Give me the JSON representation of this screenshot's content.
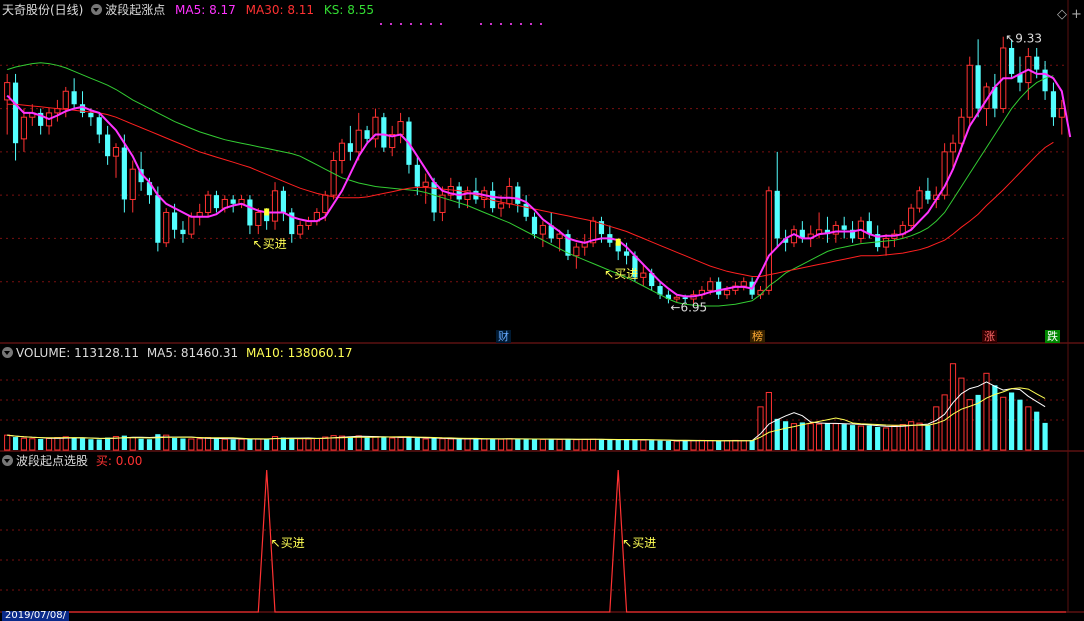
{
  "header": {
    "stock_name": "天奇股份(日线)",
    "indicator": "波段起涨点",
    "ma5": "MA5: 8.17",
    "ma30": "MA30: 8.11",
    "ks": "KS: 8.55"
  },
  "volume_panel": {
    "volume": "VOLUME: 113128.11",
    "ma5": "MA5: 81460.31",
    "ma10": "MA10: 138060.17"
  },
  "signal_panel": {
    "title": "波段起点选股",
    "buy_value": "买: 0.00"
  },
  "annotations": {
    "buy_label": "买进",
    "high_label": "9.33",
    "low_label": "6.95"
  },
  "event_badges": [
    "财",
    "榜",
    "涨",
    "跌"
  ],
  "footer_date": "2019/07/08/",
  "colors": {
    "up": "#ff3232",
    "down": "#54ffff",
    "ma5": "#ff33ff",
    "ma30_long": "#ff2020",
    "ks": "#33cc33",
    "label_yellow": "#ffff55",
    "grid": "#7a1010"
  },
  "chart_data": {
    "type": "candlestick",
    "ohlc": [
      [
        8.6,
        8.9,
        8.2,
        8.8
      ],
      [
        8.8,
        8.9,
        7.9,
        8.1
      ],
      [
        8.15,
        8.5,
        8.0,
        8.4
      ],
      [
        8.4,
        8.55,
        8.3,
        8.45
      ],
      [
        8.45,
        8.5,
        8.2,
        8.3
      ],
      [
        8.3,
        8.5,
        8.2,
        8.45
      ],
      [
        8.45,
        8.6,
        8.35,
        8.5
      ],
      [
        8.5,
        8.75,
        8.4,
        8.7
      ],
      [
        8.7,
        8.85,
        8.5,
        8.55
      ],
      [
        8.55,
        8.7,
        8.4,
        8.45
      ],
      [
        8.45,
        8.5,
        8.3,
        8.4
      ],
      [
        8.4,
        8.45,
        8.1,
        8.2
      ],
      [
        8.2,
        8.3,
        7.85,
        7.95
      ],
      [
        7.95,
        8.1,
        7.7,
        8.05
      ],
      [
        8.05,
        8.2,
        7.3,
        7.45
      ],
      [
        7.45,
        7.9,
        7.3,
        7.8
      ],
      [
        7.8,
        8.0,
        7.55,
        7.65
      ],
      [
        7.65,
        7.7,
        7.4,
        7.5
      ],
      [
        7.5,
        7.6,
        6.85,
        6.95
      ],
      [
        6.95,
        7.35,
        6.9,
        7.3
      ],
      [
        7.3,
        7.4,
        7.0,
        7.1
      ],
      [
        7.1,
        7.2,
        6.95,
        7.05
      ],
      [
        7.05,
        7.3,
        7.0,
        7.25
      ],
      [
        7.25,
        7.4,
        7.15,
        7.3
      ],
      [
        7.3,
        7.55,
        7.25,
        7.5
      ],
      [
        7.5,
        7.55,
        7.3,
        7.35
      ],
      [
        7.35,
        7.5,
        7.3,
        7.45
      ],
      [
        7.45,
        7.5,
        7.3,
        7.4
      ],
      [
        7.4,
        7.5,
        7.35,
        7.45
      ],
      [
        7.45,
        7.5,
        7.05,
        7.15
      ],
      [
        7.15,
        7.35,
        7.05,
        7.3
      ],
      [
        7.3,
        7.35,
        7.1,
        7.2
      ],
      [
        7.2,
        7.65,
        7.1,
        7.55
      ],
      [
        7.55,
        7.6,
        7.2,
        7.3
      ],
      [
        7.3,
        7.35,
        6.95,
        7.05
      ],
      [
        7.05,
        7.2,
        7.0,
        7.15
      ],
      [
        7.15,
        7.25,
        7.1,
        7.2
      ],
      [
        7.2,
        7.35,
        7.15,
        7.3
      ],
      [
        7.3,
        7.55,
        7.2,
        7.5
      ],
      [
        7.5,
        8.0,
        7.45,
        7.9
      ],
      [
        7.9,
        8.15,
        7.75,
        8.1
      ],
      [
        8.1,
        8.3,
        7.9,
        8.0
      ],
      [
        8.0,
        8.45,
        7.9,
        8.25
      ],
      [
        8.25,
        8.3,
        8.1,
        8.15
      ],
      [
        8.15,
        8.5,
        8.05,
        8.4
      ],
      [
        8.4,
        8.45,
        8.0,
        8.05
      ],
      [
        8.05,
        8.3,
        7.95,
        8.2
      ],
      [
        8.2,
        8.45,
        8.1,
        8.35
      ],
      [
        8.35,
        8.4,
        7.75,
        7.85
      ],
      [
        7.85,
        7.95,
        7.5,
        7.6
      ],
      [
        7.6,
        7.75,
        7.4,
        7.65
      ],
      [
        7.65,
        7.7,
        7.2,
        7.3
      ],
      [
        7.3,
        7.6,
        7.2,
        7.5
      ],
      [
        7.5,
        7.7,
        7.45,
        7.6
      ],
      [
        7.6,
        7.65,
        7.35,
        7.45
      ],
      [
        7.45,
        7.6,
        7.35,
        7.55
      ],
      [
        7.55,
        7.7,
        7.4,
        7.45
      ],
      [
        7.45,
        7.6,
        7.35,
        7.55
      ],
      [
        7.55,
        7.65,
        7.3,
        7.35
      ],
      [
        7.35,
        7.5,
        7.25,
        7.4
      ],
      [
        7.4,
        7.7,
        7.35,
        7.6
      ],
      [
        7.6,
        7.65,
        7.3,
        7.4
      ],
      [
        7.4,
        7.5,
        7.2,
        7.25
      ],
      [
        7.25,
        7.3,
        7.0,
        7.05
      ],
      [
        7.05,
        7.2,
        6.9,
        7.15
      ],
      [
        7.15,
        7.3,
        6.95,
        7.0
      ],
      [
        7.0,
        7.1,
        6.85,
        7.05
      ],
      [
        7.05,
        7.1,
        6.75,
        6.8
      ],
      [
        6.8,
        6.95,
        6.65,
        6.9
      ],
      [
        6.9,
        7.05,
        6.8,
        6.95
      ],
      [
        6.95,
        7.25,
        6.9,
        7.2
      ],
      [
        7.2,
        7.25,
        6.95,
        7.05
      ],
      [
        7.05,
        7.15,
        6.9,
        6.95
      ],
      [
        6.95,
        7.0,
        6.75,
        6.85
      ],
      [
        6.85,
        6.95,
        6.7,
        6.8
      ],
      [
        6.8,
        6.85,
        6.5,
        6.55
      ],
      [
        6.55,
        6.7,
        6.45,
        6.6
      ],
      [
        6.6,
        6.65,
        6.4,
        6.45
      ],
      [
        6.45,
        6.5,
        6.3,
        6.35
      ],
      [
        6.35,
        6.4,
        6.25,
        6.3
      ],
      [
        6.3,
        6.35,
        6.26,
        6.32
      ],
      [
        6.32,
        6.35,
        6.25,
        6.3
      ],
      [
        6.3,
        6.4,
        6.25,
        6.35
      ],
      [
        6.35,
        6.45,
        6.3,
        6.4
      ],
      [
        6.4,
        6.55,
        6.35,
        6.5
      ],
      [
        6.5,
        6.55,
        6.3,
        6.35
      ],
      [
        6.35,
        6.45,
        6.3,
        6.4
      ],
      [
        6.4,
        6.5,
        6.35,
        6.45
      ],
      [
        6.45,
        6.55,
        6.4,
        6.5
      ],
      [
        6.5,
        6.55,
        6.3,
        6.35
      ],
      [
        6.35,
        6.45,
        6.3,
        6.4
      ],
      [
        6.4,
        7.6,
        6.35,
        7.55
      ],
      [
        7.55,
        8.0,
        6.9,
        7.0
      ],
      [
        7.0,
        7.1,
        6.85,
        6.95
      ],
      [
        6.95,
        7.15,
        6.9,
        7.1
      ],
      [
        7.1,
        7.2,
        6.95,
        7.0
      ],
      [
        7.0,
        7.15,
        6.9,
        7.05
      ],
      [
        7.05,
        7.3,
        7.0,
        7.1
      ],
      [
        7.1,
        7.25,
        6.95,
        7.05
      ],
      [
        7.05,
        7.2,
        6.95,
        7.15
      ],
      [
        7.15,
        7.25,
        7.0,
        7.1
      ],
      [
        7.1,
        7.2,
        6.95,
        7.0
      ],
      [
        7.0,
        7.25,
        6.95,
        7.2
      ],
      [
        7.2,
        7.3,
        7.0,
        7.05
      ],
      [
        7.05,
        7.15,
        6.85,
        6.9
      ],
      [
        6.9,
        7.05,
        6.8,
        7.0
      ],
      [
        7.0,
        7.1,
        6.9,
        7.05
      ],
      [
        7.05,
        7.2,
        7.0,
        7.15
      ],
      [
        7.15,
        7.4,
        7.1,
        7.35
      ],
      [
        7.35,
        7.6,
        7.3,
        7.55
      ],
      [
        7.55,
        7.7,
        7.4,
        7.45
      ],
      [
        7.45,
        7.6,
        7.35,
        7.5
      ],
      [
        7.5,
        8.1,
        7.45,
        8.0
      ],
      [
        8.0,
        8.2,
        7.8,
        8.1
      ],
      [
        8.1,
        8.5,
        8.0,
        8.4
      ],
      [
        8.4,
        9.1,
        8.3,
        9.0
      ],
      [
        9.0,
        9.3,
        8.4,
        8.5
      ],
      [
        8.5,
        8.8,
        8.3,
        8.75
      ],
      [
        8.75,
        8.9,
        8.4,
        8.5
      ],
      [
        8.5,
        9.33,
        8.45,
        9.2
      ],
      [
        9.2,
        9.3,
        8.85,
        8.9
      ],
      [
        8.9,
        9.1,
        8.7,
        8.8
      ],
      [
        8.8,
        9.2,
        8.6,
        9.1
      ],
      [
        9.1,
        9.2,
        8.85,
        8.95
      ],
      [
        8.95,
        9.05,
        8.6,
        8.7
      ],
      [
        8.7,
        8.8,
        8.3,
        8.4
      ],
      [
        8.4,
        8.6,
        8.2,
        8.5
      ]
    ],
    "volume": [
      62000,
      54000,
      49000,
      47000,
      46000,
      48000,
      52000,
      55000,
      51000,
      48000,
      45000,
      44000,
      52000,
      56000,
      60000,
      52000,
      47000,
      45000,
      66000,
      62000,
      50000,
      48000,
      46000,
      47000,
      52000,
      48000,
      45000,
      44000,
      45000,
      47000,
      46000,
      45000,
      56000,
      52000,
      49000,
      47000,
      46000,
      48000,
      54000,
      60000,
      58000,
      55000,
      59000,
      52000,
      56000,
      53000,
      50000,
      52000,
      55000,
      50000,
      46000,
      48000,
      47000,
      46000,
      45000,
      46000,
      47000,
      46000,
      48000,
      45000,
      47000,
      46000,
      45000,
      46000,
      44000,
      45000,
      44000,
      46000,
      43000,
      44000,
      45000,
      43000,
      42000,
      43000,
      42000,
      44000,
      41000,
      40000,
      39000,
      38000,
      37000,
      38000,
      39000,
      40000,
      39000,
      38000,
      39000,
      40000,
      39000,
      41000,
      180000,
      240000,
      130000,
      120000,
      110000,
      115000,
      110000,
      108000,
      112000,
      110000,
      108000,
      104000,
      100000,
      102000,
      96000,
      92000,
      100000,
      106000,
      118000,
      112000,
      104000,
      180000,
      230000,
      360000,
      300000,
      210000,
      230000,
      320000,
      270000,
      220000,
      240000,
      210000,
      180000,
      160000,
      113128
    ],
    "ma5": [
      8.65,
      8.55,
      8.45,
      8.45,
      8.42,
      8.38,
      8.42,
      8.47,
      8.5,
      8.52,
      8.48,
      8.45,
      8.35,
      8.25,
      8.1,
      7.95,
      7.75,
      7.65,
      7.5,
      7.4,
      7.35,
      7.3,
      7.25,
      7.25,
      7.25,
      7.28,
      7.35,
      7.38,
      7.4,
      7.36,
      7.32,
      7.3,
      7.3,
      7.3,
      7.25,
      7.22,
      7.2,
      7.2,
      7.25,
      7.4,
      7.55,
      7.75,
      7.95,
      8.1,
      8.2,
      8.2,
      8.18,
      8.2,
      8.1,
      7.95,
      7.8,
      7.65,
      7.55,
      7.52,
      7.5,
      7.52,
      7.52,
      7.5,
      7.48,
      7.47,
      7.47,
      7.46,
      7.42,
      7.33,
      7.22,
      7.15,
      7.08,
      7.0,
      6.97,
      6.95,
      6.98,
      7.0,
      7.0,
      6.98,
      6.9,
      6.8,
      6.7,
      6.6,
      6.5,
      6.42,
      6.35,
      6.33,
      6.33,
      6.35,
      6.38,
      6.4,
      6.42,
      6.44,
      6.44,
      6.42,
      6.6,
      6.8,
      6.9,
      7.0,
      7.05,
      7.0,
      7.0,
      7.05,
      7.06,
      7.08,
      7.08,
      7.08,
      7.1,
      7.05,
      7.02,
      7.03,
      7.03,
      7.05,
      7.1,
      7.2,
      7.3,
      7.45,
      7.6,
      7.8,
      8.05,
      8.3,
      8.45,
      8.6,
      8.75,
      8.85,
      8.85,
      8.9,
      8.95,
      8.9,
      8.9,
      8.85,
      8.7,
      8.17
    ],
    "ma30": [
      8.55,
      8.55,
      8.54,
      8.53,
      8.52,
      8.51,
      8.5,
      8.49,
      8.48,
      8.47,
      8.46,
      8.45,
      8.43,
      8.4,
      8.36,
      8.32,
      8.28,
      8.24,
      8.2,
      8.16,
      8.12,
      8.08,
      8.04,
      8.0,
      7.97,
      7.94,
      7.91,
      7.88,
      7.85,
      7.82,
      7.78,
      7.74,
      7.7,
      7.66,
      7.62,
      7.58,
      7.55,
      7.52,
      7.5,
      7.48,
      7.47,
      7.47,
      7.47,
      7.48,
      7.5,
      7.52,
      7.54,
      7.56,
      7.58,
      7.59,
      7.59,
      7.58,
      7.57,
      7.56,
      7.55,
      7.53,
      7.5,
      7.47,
      7.44,
      7.42,
      7.4,
      7.38,
      7.36,
      7.34,
      7.32,
      7.3,
      7.28,
      7.26,
      7.24,
      7.22,
      7.2,
      7.17,
      7.14,
      7.11,
      7.08,
      7.04,
      7.0,
      6.96,
      6.92,
      6.88,
      6.84,
      6.8,
      6.76,
      6.72,
      6.68,
      6.65,
      6.62,
      6.6,
      6.58,
      6.56,
      6.56,
      6.58,
      6.6,
      6.62,
      6.64,
      6.66,
      6.68,
      6.7,
      6.72,
      6.74,
      6.76,
      6.78,
      6.8,
      6.8,
      6.8,
      6.81,
      6.82,
      6.83,
      6.85,
      6.87,
      6.9,
      6.94,
      6.98,
      7.05,
      7.13,
      7.2,
      7.28,
      7.38,
      7.47,
      7.56,
      7.66,
      7.76,
      7.86,
      7.96,
      8.05,
      8.11
    ],
    "ks": [
      8.95,
      8.98,
      9.0,
      9.02,
      9.03,
      9.02,
      9.0,
      8.97,
      8.93,
      8.89,
      8.85,
      8.81,
      8.77,
      8.72,
      8.66,
      8.6,
      8.55,
      8.5,
      8.45,
      8.4,
      8.35,
      8.31,
      8.27,
      8.23,
      8.2,
      8.17,
      8.14,
      8.12,
      8.1,
      8.08,
      8.06,
      8.04,
      8.02,
      8.0,
      7.98,
      7.95,
      7.9,
      7.85,
      7.8,
      7.75,
      7.7,
      7.67,
      7.64,
      7.62,
      7.6,
      7.59,
      7.58,
      7.57,
      7.56,
      7.55,
      7.53,
      7.5,
      7.47,
      7.44,
      7.41,
      7.38,
      7.34,
      7.3,
      7.26,
      7.22,
      7.18,
      7.13,
      7.08,
      7.03,
      6.98,
      6.93,
      6.88,
      6.83,
      6.79,
      6.75,
      6.71,
      6.67,
      6.63,
      6.59,
      6.55,
      6.5,
      6.45,
      6.4,
      6.35,
      6.3,
      6.26,
      6.24,
      6.23,
      6.22,
      6.22,
      6.22,
      6.23,
      6.24,
      6.26,
      6.28,
      6.35,
      6.45,
      6.52,
      6.6,
      6.65,
      6.7,
      6.75,
      6.8,
      6.85,
      6.88,
      6.9,
      6.92,
      6.94,
      6.95,
      6.96,
      6.97,
      6.98,
      7.0,
      7.03,
      7.07,
      7.12,
      7.2,
      7.3,
      7.45,
      7.6,
      7.75,
      7.9,
      8.05,
      8.2,
      8.35,
      8.5,
      8.62,
      8.72,
      8.8,
      8.85,
      8.88
    ],
    "price_range": [
      6.0,
      9.5
    ],
    "buy_signals": [
      31,
      73
    ]
  }
}
